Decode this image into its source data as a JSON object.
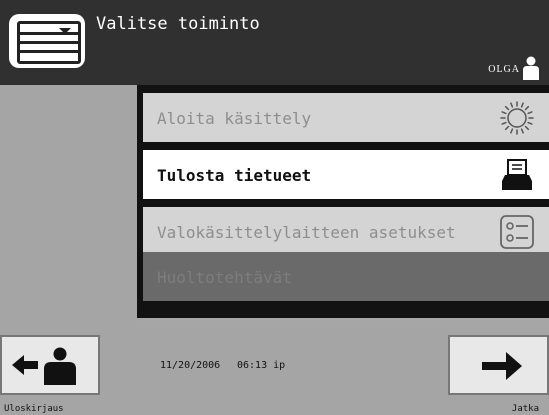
{
  "header": {
    "title": "Valitse toiminto",
    "user": "OLGA",
    "icons": {
      "screen": "screen-menu-icon",
      "user": "user-icon"
    }
  },
  "menu": {
    "items": [
      {
        "label": "Aloita käsittely",
        "state": "disabled",
        "icon": "sun-icon"
      },
      {
        "label": "Tulosta tietueet",
        "state": "active",
        "icon": "printer-icon"
      },
      {
        "label": "Valokäsittelylaitteen asetukset",
        "state": "disabled",
        "icon": "settings-list-icon"
      },
      {
        "label": "Huoltotehtävät",
        "state": "dim",
        "icon": ""
      }
    ]
  },
  "footer": {
    "date": "11/20/2006",
    "time": "06:13 ip",
    "logout_label": "Uloskirjaus",
    "continue_label": "Jatka"
  },
  "colors": {
    "header_bg": "#303030",
    "panel_bg": "#a5a5a5",
    "active_bg": "#ffffff",
    "disabled_bg": "#d4d4d4"
  }
}
